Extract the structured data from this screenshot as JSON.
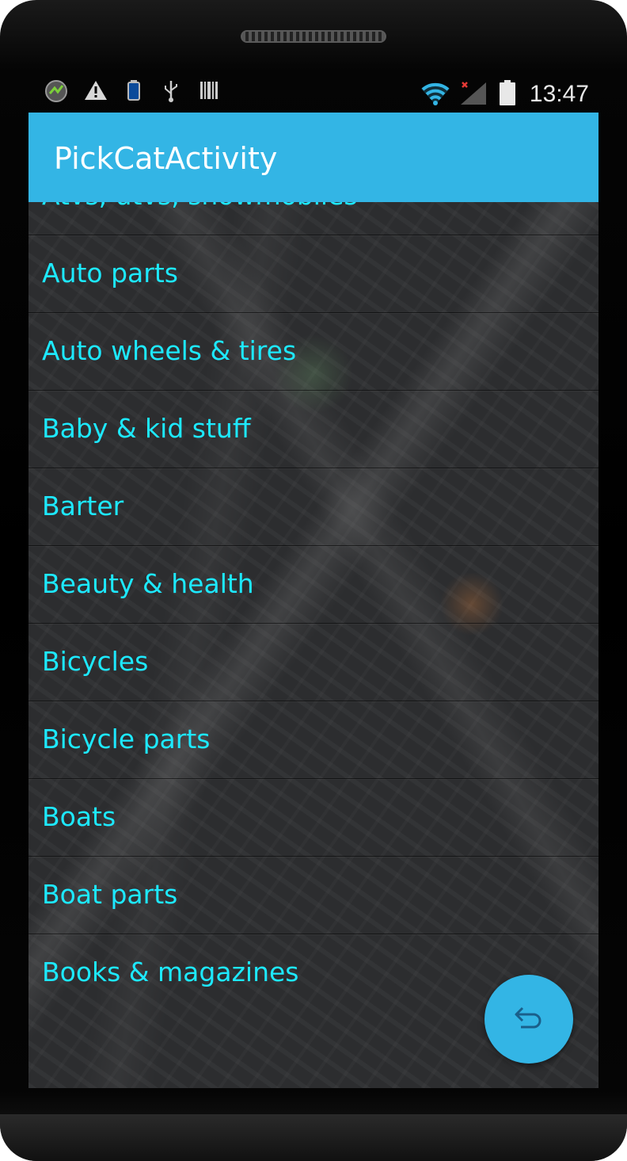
{
  "status_bar": {
    "time": "13:47",
    "left_icons": [
      "app-icon",
      "warning-icon",
      "battery-small-icon",
      "usb-icon",
      "barcode-icon"
    ],
    "right_icons": [
      "wifi-icon",
      "signal-off-icon",
      "battery-icon"
    ]
  },
  "action_bar": {
    "title": "PickCatActivity",
    "color": "#33b5e5"
  },
  "categories": [
    "Atvs, utvs, snowmobiles",
    "Auto parts",
    "Auto wheels & tires",
    "Baby & kid stuff",
    "Barter",
    "Beauty & health",
    "Bicycles",
    "Bicycle parts",
    "Boats",
    "Boat parts",
    "Books & magazines"
  ],
  "colors": {
    "item_text": "#1de9ff",
    "accent": "#33b5e5"
  },
  "fab": {
    "icon": "undo-icon"
  }
}
